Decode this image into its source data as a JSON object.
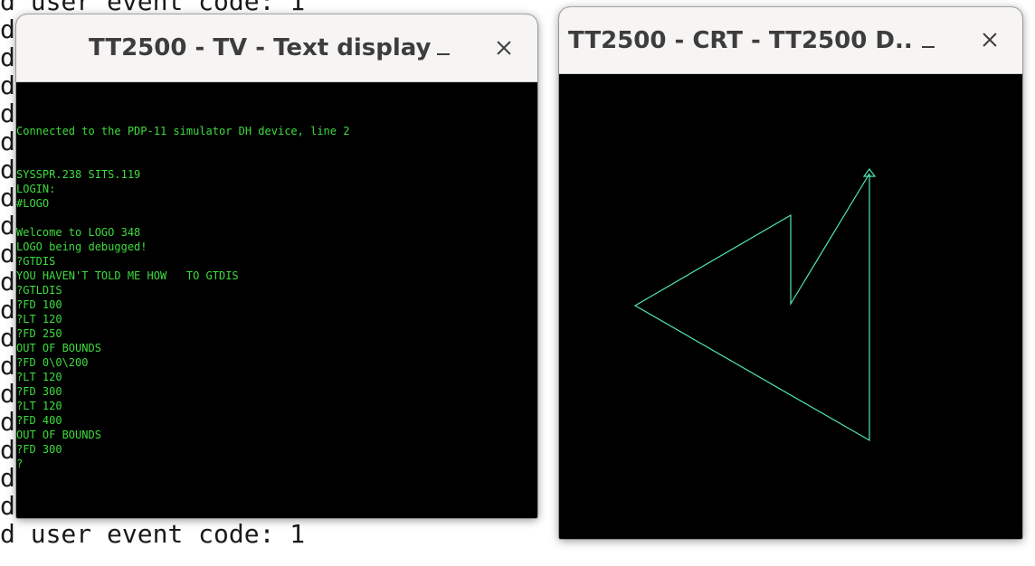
{
  "background_terminal": {
    "lines": [
      "d user event code: 1",
      "d",
      "d",
      "d",
      "d",
      "d",
      "d",
      "d",
      "d",
      "d",
      "d",
      "d",
      "d",
      "d",
      "d",
      "d",
      "d",
      "d",
      "d user event code: 1",
      "d user event code: 1"
    ]
  },
  "tv_window": {
    "title": "TT2500 - TV - Text display",
    "lines": [
      "",
      "Connected to the PDP-11 simulator DH device, line 2",
      "",
      "",
      "SYSSPR.238 SITS.119",
      "LOGIN:",
      "#LOGO",
      "",
      "Welcome to LOGO 348",
      "LOGO being debugged!",
      "?GTDIS",
      "YOU HAVEN'T TOLD ME HOW   TO GTDIS",
      "?GTLDIS",
      "?FD 100",
      "?LT 120",
      "?FD 250",
      "OUT OF BOUNDS",
      "?FD 0\\0\\200",
      "?LT 120",
      "?FD 300",
      "?LT 120",
      "?FD 400",
      "OUT OF BOUNDS",
      "?FD 300",
      "?"
    ],
    "text_color": "#3ddc3d"
  },
  "crt_window": {
    "title": "TT2500 - CRT - TT2500 D...",
    "line_color": "#4fe8b0"
  }
}
